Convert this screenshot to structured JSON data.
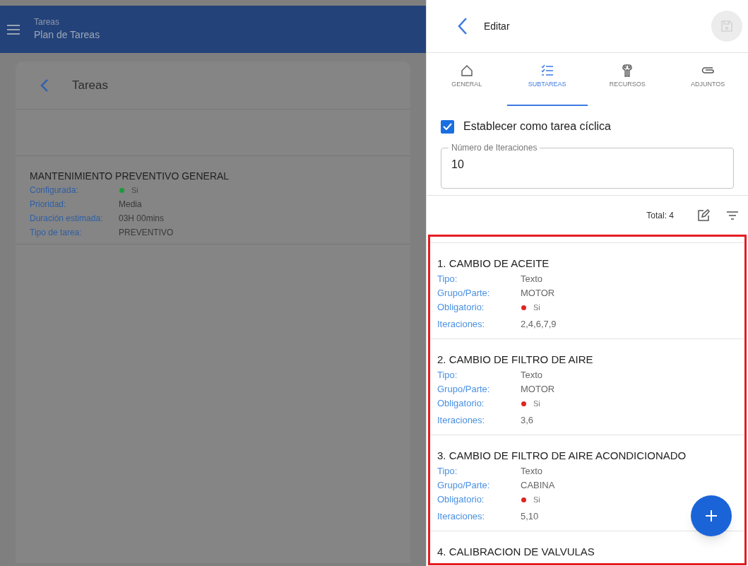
{
  "background": {
    "header": {
      "section": "Tareas",
      "title": "Plan de Tareas"
    },
    "card": {
      "title": "Tareas",
      "task": {
        "title": "MANTENIMIENTO PREVENTIVO GENERAL",
        "fields": [
          {
            "kind": "dot",
            "label": "Configurada:",
            "value": "Si",
            "color": "#1a9c3a"
          },
          {
            "kind": "text",
            "label": "Prioridad:",
            "value": "Media"
          },
          {
            "kind": "text",
            "label": "Duración estimada:",
            "value": "03H 00mins"
          },
          {
            "kind": "text",
            "label": "Tipo de tarea:",
            "value": "PREVENTIVO"
          }
        ]
      }
    }
  },
  "panel": {
    "title": "Editar",
    "tabs": [
      {
        "kind": "home",
        "label": "GENERAL",
        "selected": false
      },
      {
        "kind": "checklist",
        "label": "SUBTAREAS",
        "selected": true
      },
      {
        "kind": "wrench",
        "label": "RECURSOS",
        "selected": false
      },
      {
        "kind": "clip",
        "label": "ADJUNTOS",
        "selected": false
      }
    ],
    "cyclic": {
      "label": "Establecer como tarea cíclica",
      "checked": true
    },
    "iterations": {
      "label": "Número de Iteraciones",
      "value": "10"
    },
    "total": "Total: 4",
    "subtasks": [
      {
        "title": "1. CAMBIO DE ACEITE",
        "fields": [
          {
            "kind": "text",
            "label": "Tipo:",
            "value": "Texto"
          },
          {
            "kind": "text",
            "label": "Grupo/Parte:",
            "value": "MOTOR"
          },
          {
            "kind": "dot",
            "label": "Obligatorio:",
            "value": "Si",
            "color": "#e02424"
          },
          {
            "kind": "text",
            "label": "Iteraciones:",
            "value": "2,4,6,7,9"
          }
        ]
      },
      {
        "title": "2. CAMBIO DE FILTRO DE AIRE",
        "fields": [
          {
            "kind": "text",
            "label": "Tipo:",
            "value": "Texto"
          },
          {
            "kind": "text",
            "label": "Grupo/Parte:",
            "value": "MOTOR"
          },
          {
            "kind": "dot",
            "label": "Obligatorio:",
            "value": "Si",
            "color": "#e02424"
          },
          {
            "kind": "text",
            "label": "Iteraciones:",
            "value": "3,6"
          }
        ]
      },
      {
        "title": "3. CAMBIO DE FILTRO DE AIRE ACONDICIONADO",
        "fields": [
          {
            "kind": "text",
            "label": "Tipo:",
            "value": "Texto"
          },
          {
            "kind": "text",
            "label": "Grupo/Parte:",
            "value": "CABINA"
          },
          {
            "kind": "dot",
            "label": "Obligatorio:",
            "value": "Si",
            "color": "#e02424"
          },
          {
            "kind": "text",
            "label": "Iteraciones:",
            "value": "5,10"
          }
        ]
      },
      {
        "title": "4. CALIBRACION DE VALVULAS"
      }
    ]
  }
}
